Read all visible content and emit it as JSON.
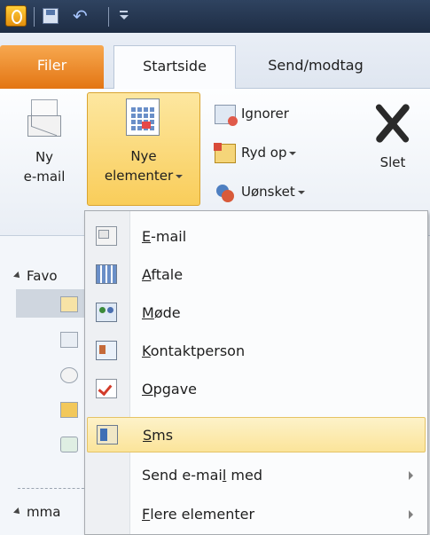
{
  "tabs": {
    "file": "Filer",
    "home": "Startside",
    "send_receive": "Send/modtag"
  },
  "ribbon": {
    "new_email": {
      "line1": "Ny",
      "line2": "e-mail"
    },
    "new_items": {
      "line1": "Nye",
      "line2": "elementer"
    },
    "ignore": "Ignorer",
    "clean_up": "Ryd op",
    "junk": "Uønsket",
    "delete": "Slet"
  },
  "nav": {
    "favorites_partial": "Favo",
    "mailbox_partial": "mma"
  },
  "menu": {
    "items": [
      {
        "pre": "",
        "acc": "E",
        "post": "-mail",
        "icon": "email-icon"
      },
      {
        "pre": "",
        "acc": "A",
        "post": "ftale",
        "icon": "appointment-icon"
      },
      {
        "pre": "",
        "acc": "M",
        "post": "øde",
        "icon": "meeting-icon"
      },
      {
        "pre": "",
        "acc": "K",
        "post": "ontaktperson",
        "icon": "contact-icon"
      },
      {
        "pre": "",
        "acc": "O",
        "post": "pgave",
        "icon": "task-icon"
      },
      {
        "pre": "",
        "acc": "S",
        "post": "ms",
        "icon": "sms-icon"
      },
      {
        "pre": "Send e-mai",
        "acc": "l",
        "post": " med",
        "icon": ""
      },
      {
        "pre": "",
        "acc": "F",
        "post": "lere elementer",
        "icon": ""
      }
    ],
    "highlighted_index": 5
  },
  "colors": {
    "file_tab": "#e37513",
    "highlight": "#fbe49a",
    "title_bar": "#1e2d44"
  }
}
